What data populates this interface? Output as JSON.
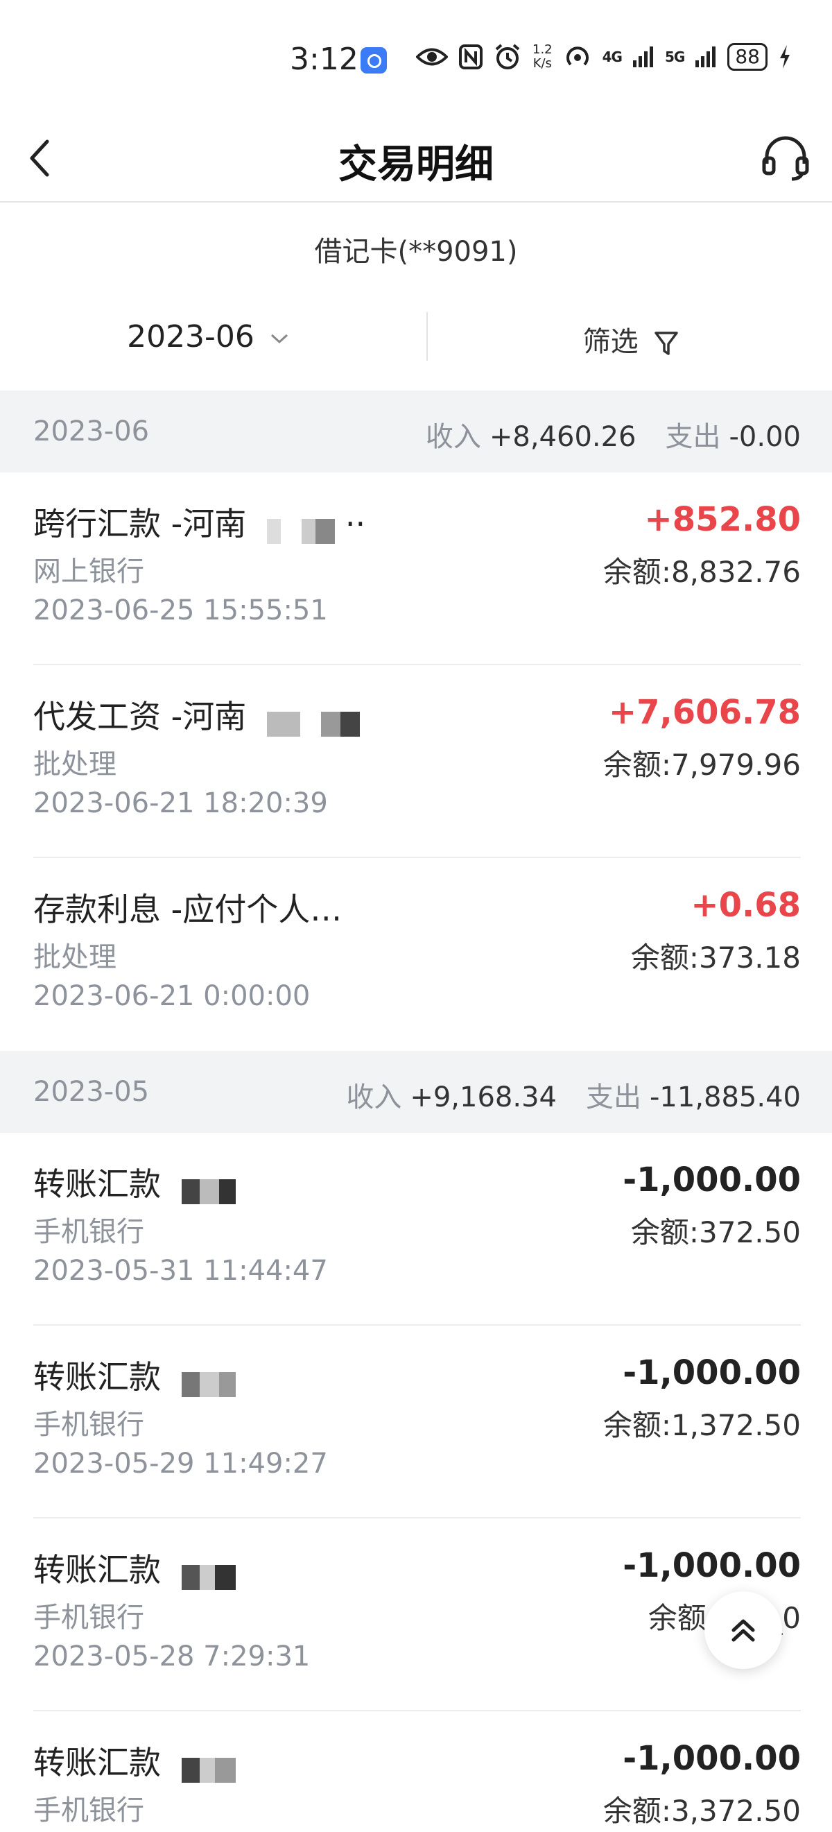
{
  "status_bar": {
    "time": "3:12",
    "speed_top": "1.2",
    "speed_bottom": "K/s",
    "net1": "4G",
    "net2": "5G",
    "battery": "88",
    "icons": [
      "notification-icon",
      "eye-icon",
      "nfc-icon",
      "alarm-icon",
      "hotspot-icon",
      "signal-icon",
      "battery-icon",
      "charging-icon"
    ]
  },
  "header": {
    "title": "交易明细",
    "back_icon": "chevron-left-icon",
    "service_icon": "headset-icon"
  },
  "card": {
    "label": "借记卡(**9091)"
  },
  "filters": {
    "month": "2023-06",
    "month_icon": "chevron-down-icon",
    "screen": "筛选",
    "screen_icon": "filter-icon"
  },
  "sections": [
    {
      "month": "2023-06",
      "income_label": "收入",
      "income": "+8,460.26",
      "expense_label": "支出",
      "expense": "-0.00",
      "items": [
        {
          "title": "跨行汇款 -河南",
          "channel": "网上银行",
          "time": "2023-06-25 15:55:51",
          "amount": "+852.80",
          "balance": "余额:8,832.76"
        },
        {
          "title": "代发工资 -河南",
          "channel": "批处理",
          "time": "2023-06-21 18:20:39",
          "amount": "+7,606.78",
          "balance": "余额:7,979.96"
        },
        {
          "title": "存款利息 -应付个人…",
          "channel": "批处理",
          "time": "2023-06-21 0:00:00",
          "amount": "+0.68",
          "balance": "余额:373.18"
        }
      ]
    },
    {
      "month": "2023-05",
      "income_label": "收入",
      "income": "+9,168.34",
      "expense_label": "支出",
      "expense": "-11,885.40",
      "items": [
        {
          "title": "转账汇款",
          "channel": "手机银行",
          "time": "2023-05-31 11:44:47",
          "amount": "-1,000.00",
          "balance": "余额:372.50"
        },
        {
          "title": "转账汇款",
          "channel": "手机银行",
          "time": "2023-05-29 11:49:27",
          "amount": "-1,000.00",
          "balance": "余额:1,372.50"
        },
        {
          "title": "转账汇款",
          "channel": "手机银行",
          "time": "2023-05-28 7:29:31",
          "amount": "-1,000.00",
          "balance": "余额:2,_,_0"
        },
        {
          "title": "转账汇款",
          "channel": "手机银行",
          "time": "",
          "amount": "-1,000.00",
          "balance": "余额:3,372.50"
        }
      ]
    }
  ],
  "back_to_top_icon": "double-chevron-up-icon",
  "colors": {
    "positive": "#e8464a",
    "muted": "#8d929b",
    "section_bg": "#f2f3f5"
  }
}
